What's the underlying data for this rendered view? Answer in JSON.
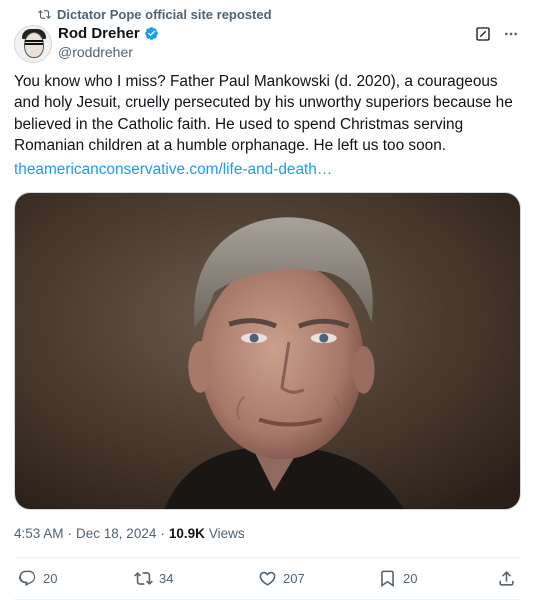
{
  "repost": {
    "text": "Dictator Pope official site reposted",
    "icon": "repost-icon"
  },
  "author": {
    "name": "Rod Dreher",
    "handle": "@roddreher",
    "verified": true,
    "verified_color": "#1d9bf0"
  },
  "tweet": {
    "text": "You know who I miss? Father Paul Mankowski (d. 2020), a courageous and holy Jesuit, cruelly persecuted by his unworthy superiors because he believed in the Catholic faith. He used to spend Christmas serving Romanian children at a humble orphanage. He left us too soon.",
    "link_text": "theamericanconservative.com/life-and-death…"
  },
  "meta": {
    "time": "4:53 AM",
    "separator": "·",
    "date": "Dec 18, 2024",
    "separator2": "·",
    "views_count": "10.9K",
    "views_label": "Views"
  },
  "actions": {
    "replies": "20",
    "reposts": "34",
    "likes": "207",
    "bookmarks": "20"
  },
  "colors": {
    "text_primary": "#0f1419",
    "text_secondary": "#536471",
    "link": "#1d9bf0",
    "divider": "#eff3f4"
  }
}
